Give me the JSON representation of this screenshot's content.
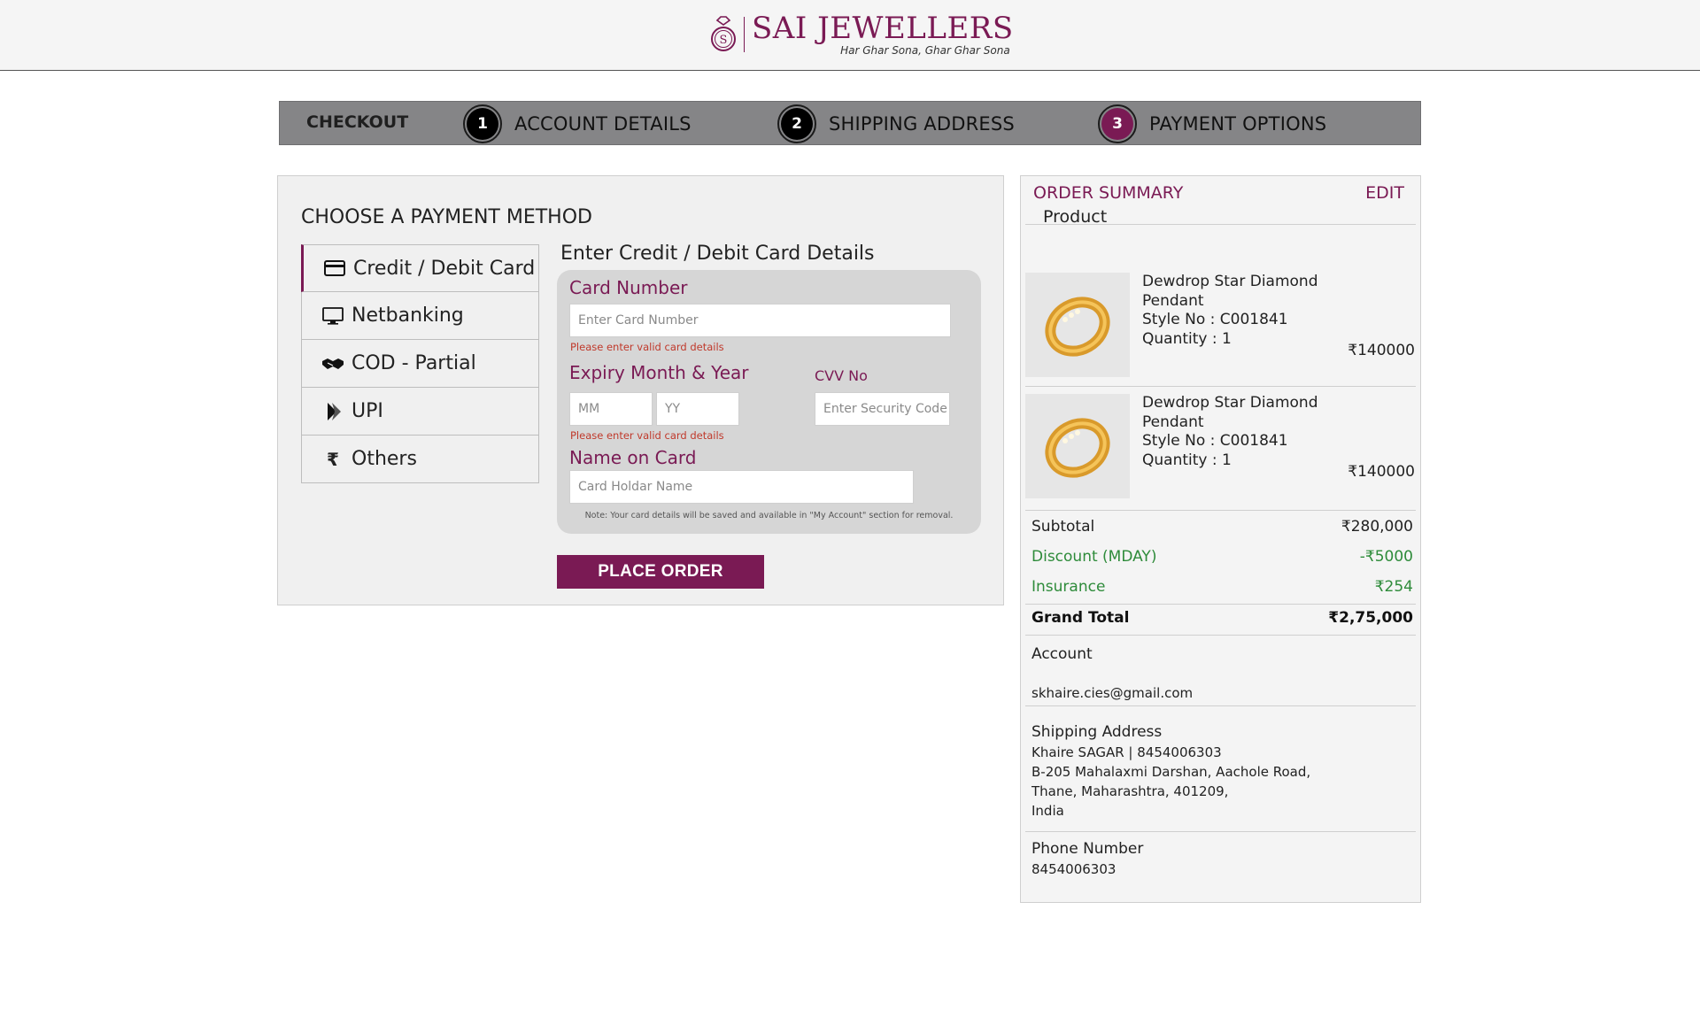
{
  "brand": {
    "name": "SAI JEWELLERS",
    "tagline": "Har Ghar Sona, Ghar Ghar Sona",
    "color": "#7a1a54"
  },
  "steps": {
    "checkout_label": "CHECKOUT",
    "items": [
      {
        "num": "1",
        "label": "ACCOUNT DETAILS"
      },
      {
        "num": "2",
        "label": "SHIPPING ADDRESS"
      },
      {
        "num": "3",
        "label": "PAYMENT OPTIONS"
      }
    ]
  },
  "payment": {
    "title": "CHOOSE A PAYMENT METHOD",
    "methods": [
      {
        "label": "Credit / Debit Card",
        "icon": "credit-card-icon"
      },
      {
        "label": "Netbanking",
        "icon": "monitor-icon"
      },
      {
        "label": "COD - Partial",
        "icon": "handshake-icon"
      },
      {
        "label": "UPI",
        "icon": "upi-icon"
      },
      {
        "label": "Others",
        "icon": "rupee-icon"
      }
    ],
    "card_form": {
      "heading": "Enter Credit / Debit Card Details",
      "card_number_label": "Card Number",
      "card_number_placeholder": "Enter Card Number",
      "card_error": "Please enter valid card details",
      "expiry_label": "Expiry Month & Year",
      "mm_placeholder": "MM",
      "yy_placeholder": "YY",
      "expiry_error": "Please enter valid card details",
      "cvv_label": "CVV No",
      "cvv_placeholder": "Enter Security Code",
      "name_label": "Name on Card",
      "name_placeholder": "Card Holdar Name",
      "note": "Note: Your card details will be saved and available in \"My Account\" section for removal."
    },
    "place_order_label": "PLACE ORDER"
  },
  "summary": {
    "title": "ORDER SUMMARY",
    "edit_label": "EDIT",
    "product_header": "Product",
    "products": [
      {
        "name": "Dewdrop Star Diamond Pendant",
        "style": "Style No : C001841",
        "quantity": "Quantity : 1",
        "price": "₹140000"
      },
      {
        "name": "Dewdrop Star Diamond Pendant",
        "style": "Style No : C001841",
        "quantity": "Quantity : 1",
        "price": "₹140000"
      }
    ],
    "subtotal_label": "Subtotal",
    "subtotal_value": "₹280,000",
    "discount_label": "Discount (MDAY)",
    "discount_value": "-₹5000",
    "insurance_label": "Insurance",
    "insurance_value": "₹254",
    "grand_total_label": "Grand Total",
    "grand_total_value": "₹2,75,000",
    "account_label": "Account",
    "account_email": "skhaire.cies@gmail.com",
    "shipping_label": "Shipping Address",
    "shipping_lines": [
      "Khaire SAGAR | 8454006303",
      "B-205 Mahalaxmi Darshan, Aachole Road,",
      "Thane, Maharashtra, 401209,",
      "India"
    ],
    "phone_label": "Phone Number",
    "phone_value": "8454006303"
  }
}
